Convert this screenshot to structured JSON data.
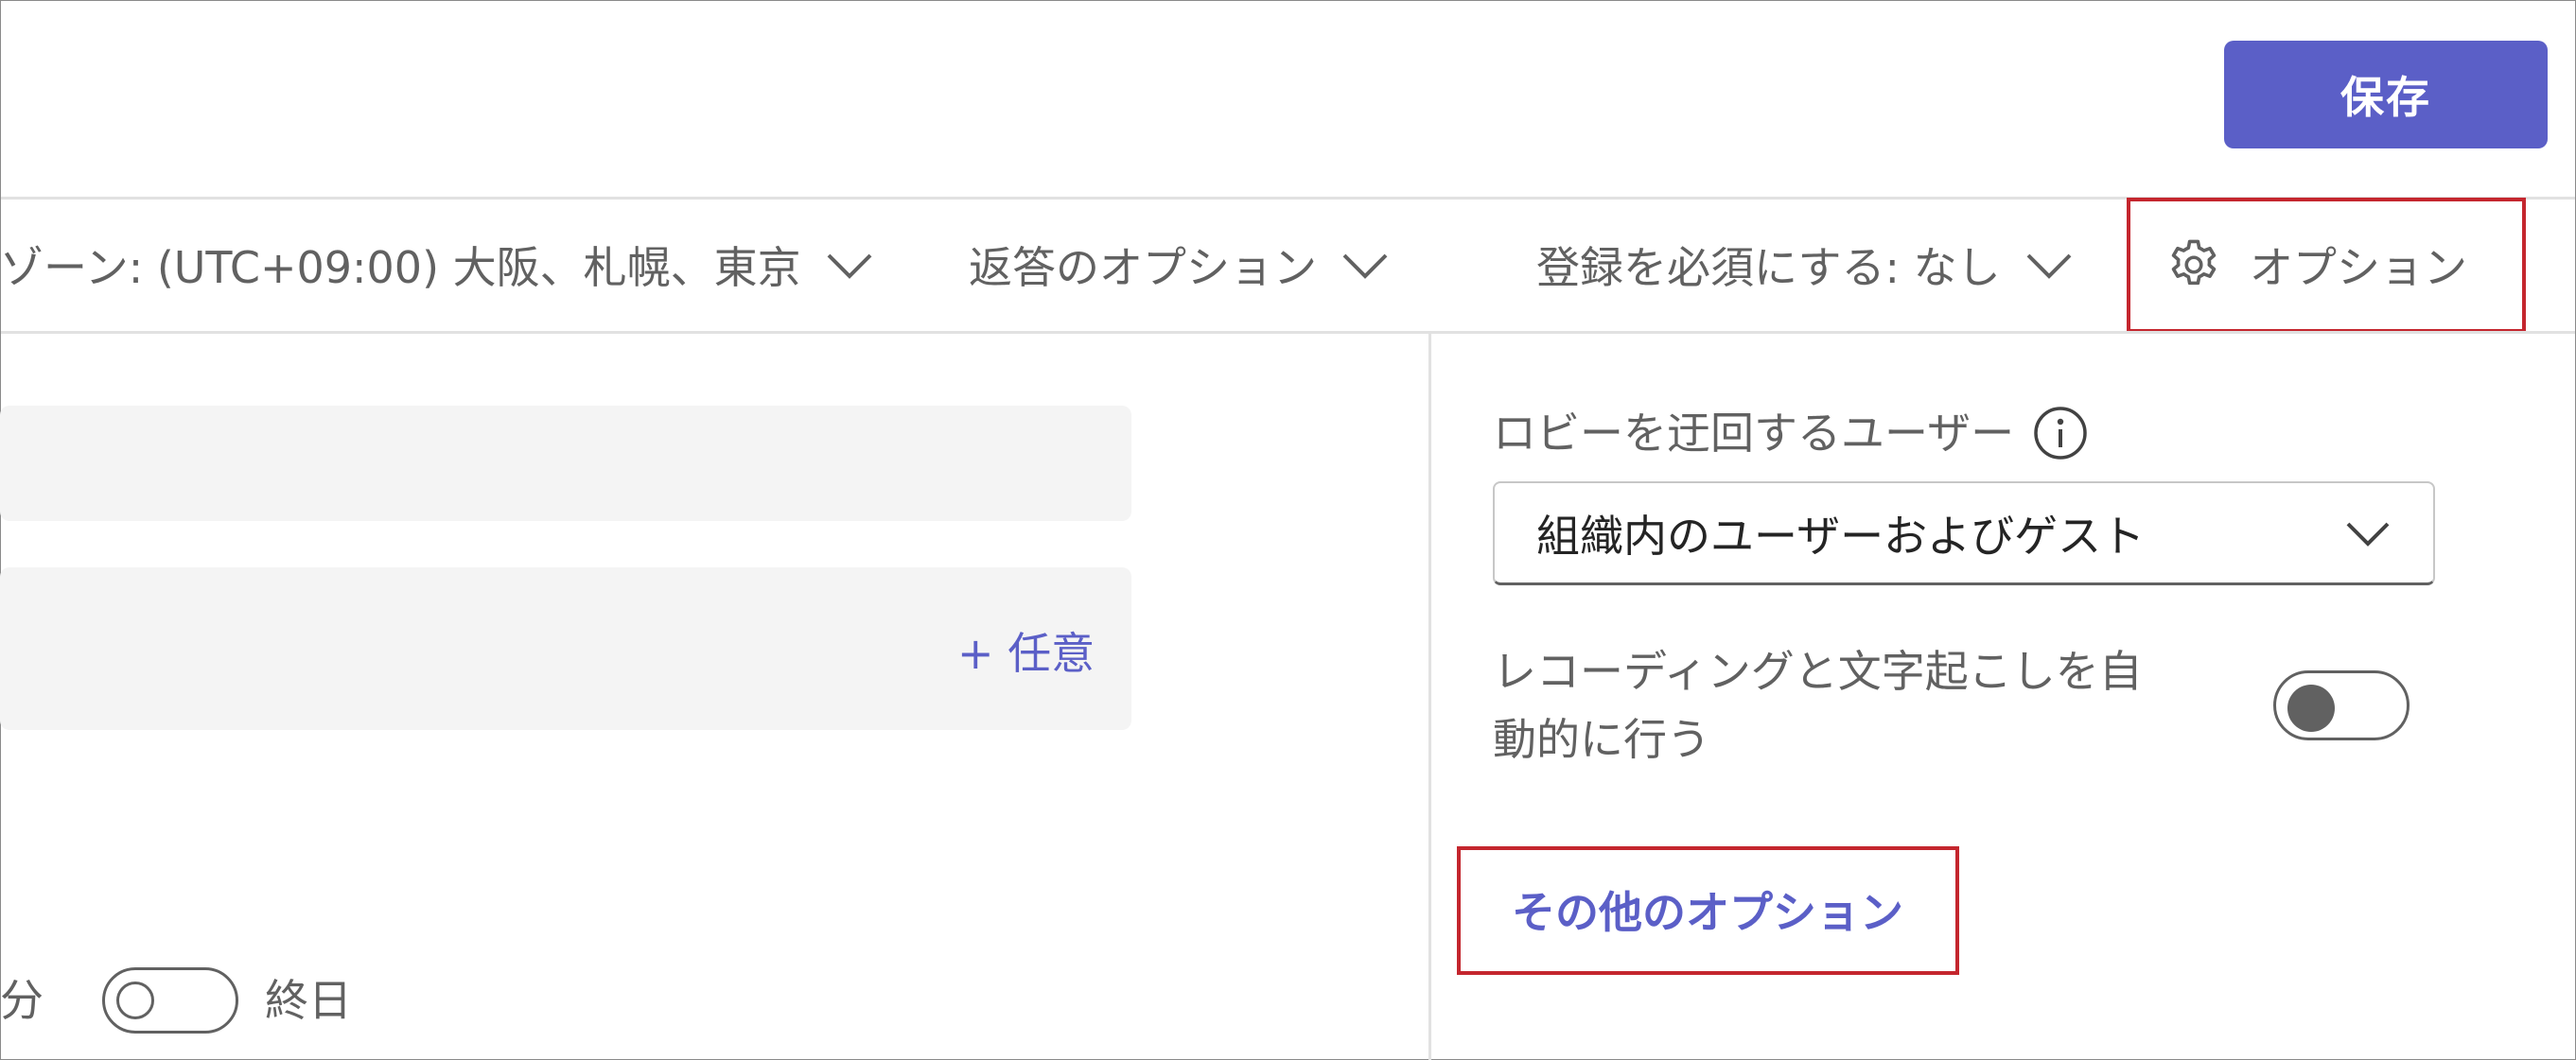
{
  "header": {
    "save_label": "保存"
  },
  "toolbar": {
    "timezone_label": "ゾーン: (UTC+09:00) 大阪、札幌、東京",
    "response_options_label": "返答のオプション",
    "registration_label": "登録を必須にする: なし",
    "options_label": "オプション"
  },
  "main": {
    "optional_link": "+ 任意",
    "minutes_fragment": "分",
    "all_day_label": "終日",
    "all_day_enabled": false
  },
  "options_panel": {
    "bypass_lobby_label": "ロビーを迂回するユーザー",
    "bypass_lobby_value": "組織内のユーザーおよびゲスト",
    "auto_record_label_line1": "レコーディングと文字起こしを自",
    "auto_record_label_line2": "動的に行う",
    "auto_record_enabled": false,
    "more_options_link": "その他のオプション"
  },
  "colors": {
    "accent": "#5b5fc7",
    "highlight_border": "#c4262e"
  }
}
